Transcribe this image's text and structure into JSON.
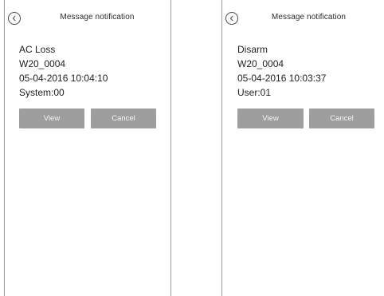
{
  "screens": [
    {
      "title": "Message notification",
      "lines": [
        "AC Loss",
        "W20_0004",
        "05-04-2016 10:04:10",
        "System:00"
      ],
      "view_label": "View",
      "cancel_label": "Cancel"
    },
    {
      "title": "Message notification",
      "lines": [
        "Disarm",
        "W20_0004",
        "05-04-2016 10:03:37",
        "User:01"
      ],
      "view_label": "View",
      "cancel_label": "Cancel"
    }
  ],
  "icons": {
    "back": "chevron-left-circle-icon"
  },
  "colors": {
    "button_bg": "#9e9e9e",
    "button_text": "#f4f4f4",
    "border": "#9a9a9a"
  }
}
